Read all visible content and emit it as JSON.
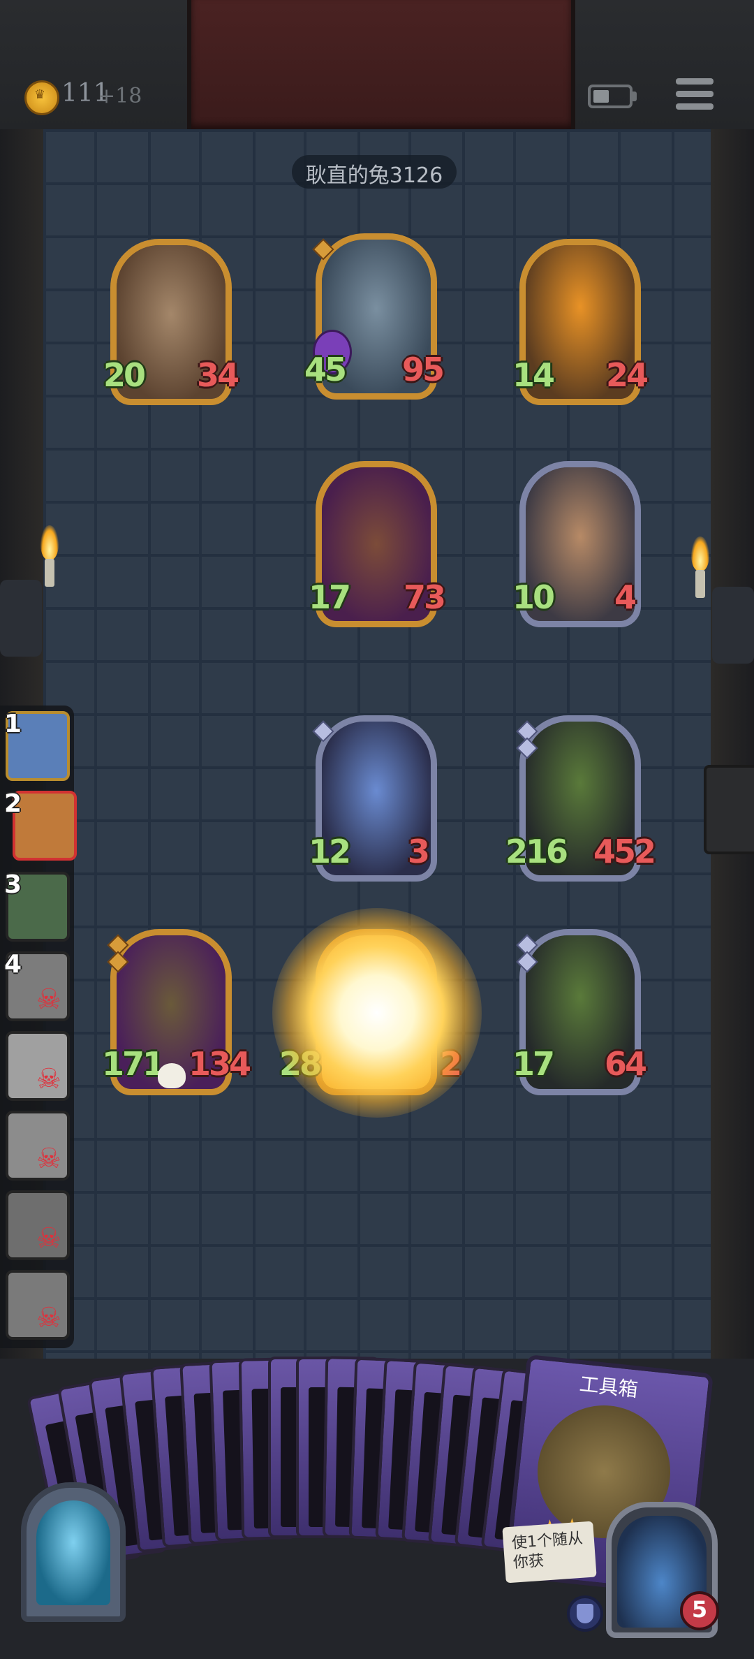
{
  "header": {
    "gold": "111",
    "gold_income": "+18",
    "opponent_name": "耿直的兔3126"
  },
  "board": {
    "enemy_cards": [
      {
        "name": "treant",
        "atk": "20",
        "hp": "34"
      },
      {
        "name": "armored-goblin",
        "atk": "45",
        "hp": "95"
      },
      {
        "name": "pumpkin-ghost",
        "atk": "14",
        "hp": "24"
      },
      {
        "name": "tiki-totem",
        "atk": "17",
        "hp": "73"
      },
      {
        "name": "detective",
        "atk": "10",
        "hp": "4"
      }
    ],
    "player_cards": [
      {
        "name": "elf-sorceress",
        "atk": "12",
        "hp": "3"
      },
      {
        "name": "carnivorous-plant",
        "atk": "216",
        "hp": "452"
      },
      {
        "name": "swamp-witch",
        "atk": "171",
        "hp": "134"
      },
      {
        "name": "exploding-card",
        "atk": "28",
        "hp": "2"
      },
      {
        "name": "carnivorous-plant-2",
        "atk": "17",
        "hp": "64"
      }
    ]
  },
  "queue": [
    {
      "num": "1",
      "dead": false
    },
    {
      "num": "2",
      "dead": false
    },
    {
      "num": "3",
      "dead": false
    },
    {
      "num": "4",
      "dead": true
    },
    {
      "num": "",
      "dead": true
    },
    {
      "num": "",
      "dead": true
    },
    {
      "num": "",
      "dead": true
    },
    {
      "num": "",
      "dead": true
    }
  ],
  "hand": {
    "featured_card_title": "工具箱",
    "featured_card_desc": "使1个随从你获"
  },
  "hero": {
    "hp": "5"
  },
  "colors": {
    "atk": "#a8e07f",
    "hp": "#e85a5a",
    "gold_frame": "#c98e30",
    "silver_frame": "#7d84a6",
    "selected_queue_border": "#d23232"
  }
}
